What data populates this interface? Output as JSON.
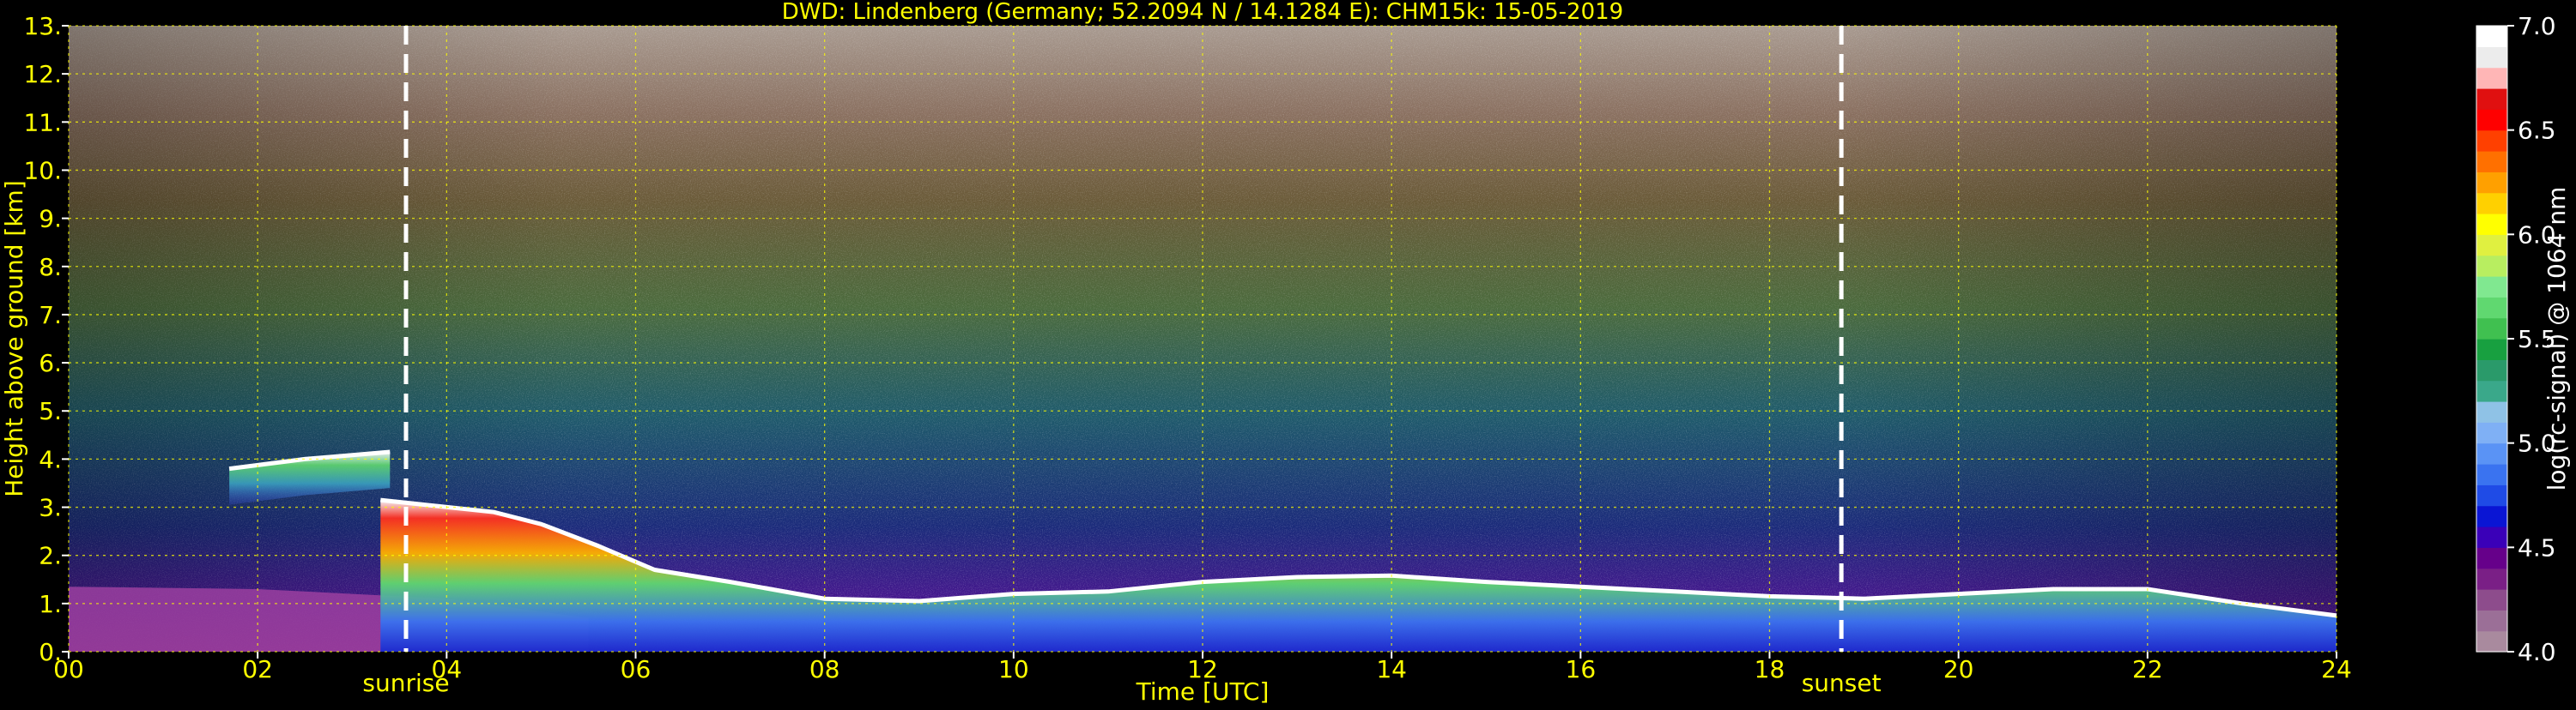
{
  "chart_data": {
    "type": "heatmap",
    "title": "DWD: Lindenberg (Germany; 52.2094 N / 14.1284 E):    CHM15k: 15-05-2019",
    "xlabel": "Time [UTC]",
    "ylabel": "Height above ground [km]",
    "xlim": [
      0,
      24
    ],
    "ylim": [
      0,
      13
    ],
    "x_ticks": [
      0,
      2,
      4,
      6,
      8,
      10,
      12,
      14,
      16,
      18,
      20,
      22,
      24
    ],
    "x_tick_labels": [
      "00",
      "02",
      "04",
      "06",
      "08",
      "10",
      "12",
      "14",
      "16",
      "18",
      "20",
      "22",
      "24"
    ],
    "y_ticks": [
      0,
      1,
      2,
      3,
      4,
      5,
      6,
      7,
      8,
      9,
      10,
      11,
      12,
      13
    ],
    "y_tick_labels": [
      "0.",
      "1.",
      "2.",
      "3.",
      "4.",
      "5.",
      "6.",
      "7.",
      "8.",
      "9.",
      "10.",
      "11.",
      "12.",
      "13."
    ],
    "grid": true,
    "grid_color": "#ffff00",
    "annotations": [
      {
        "label": "sunrise",
        "time": 3.57
      },
      {
        "label": "sunset",
        "time": 18.76
      }
    ],
    "colorbar": {
      "label": "log(rc-signal) @ 1064 nm",
      "range": [
        4.0,
        7.0
      ],
      "ticks": [
        4.0,
        4.5,
        5.0,
        5.5,
        6.0,
        6.5,
        7.0
      ],
      "tick_labels": [
        "4.0",
        "4.5",
        "5.0",
        "5.5",
        "6.0",
        "6.5",
        "7.0"
      ],
      "colors": [
        "#a98a9e",
        "#9b6f97",
        "#8d4c8c",
        "#7a1f86",
        "#66008a",
        "#3a00b8",
        "#0a15d4",
        "#1f4be6",
        "#3a73f0",
        "#5a93f5",
        "#7fb0f5",
        "#8fc2e6",
        "#3aa88a",
        "#2a9a6a",
        "#18a040",
        "#40c050",
        "#60d870",
        "#80e890",
        "#b8ee60",
        "#e0f040",
        "#ffff00",
        "#ffd000",
        "#ffa000",
        "#ff7000",
        "#ff4000",
        "#ff0000",
        "#e01010",
        "#ffb6b6",
        "#ececec",
        "#ffffff"
      ]
    },
    "features": {
      "boundary_layer_top_km": [
        [
          3.3,
          3.15
        ],
        [
          4.5,
          2.9
        ],
        [
          5.0,
          2.65
        ],
        [
          5.6,
          2.2
        ],
        [
          6.2,
          1.7
        ],
        [
          7.0,
          1.45
        ],
        [
          8.0,
          1.1
        ],
        [
          9.0,
          1.05
        ],
        [
          10.0,
          1.2
        ],
        [
          11.0,
          1.25
        ],
        [
          12.0,
          1.45
        ],
        [
          13.0,
          1.55
        ],
        [
          14.0,
          1.58
        ],
        [
          15.0,
          1.45
        ],
        [
          16.0,
          1.35
        ],
        [
          17.0,
          1.25
        ],
        [
          18.0,
          1.15
        ],
        [
          19.0,
          1.1
        ],
        [
          20.0,
          1.2
        ],
        [
          21.0,
          1.3
        ],
        [
          22.0,
          1.3
        ],
        [
          23.0,
          1.0
        ],
        [
          24.0,
          0.75
        ]
      ],
      "residual_layer_km": [
        [
          1.7,
          3.8
        ],
        [
          2.5,
          4.0
        ],
        [
          3.4,
          4.15
        ]
      ],
      "aerosol_layer_top_km": [
        [
          0,
          1.35
        ],
        [
          2.0,
          1.3
        ],
        [
          4.0,
          1.1
        ],
        [
          5.5,
          0.7
        ]
      ]
    }
  }
}
